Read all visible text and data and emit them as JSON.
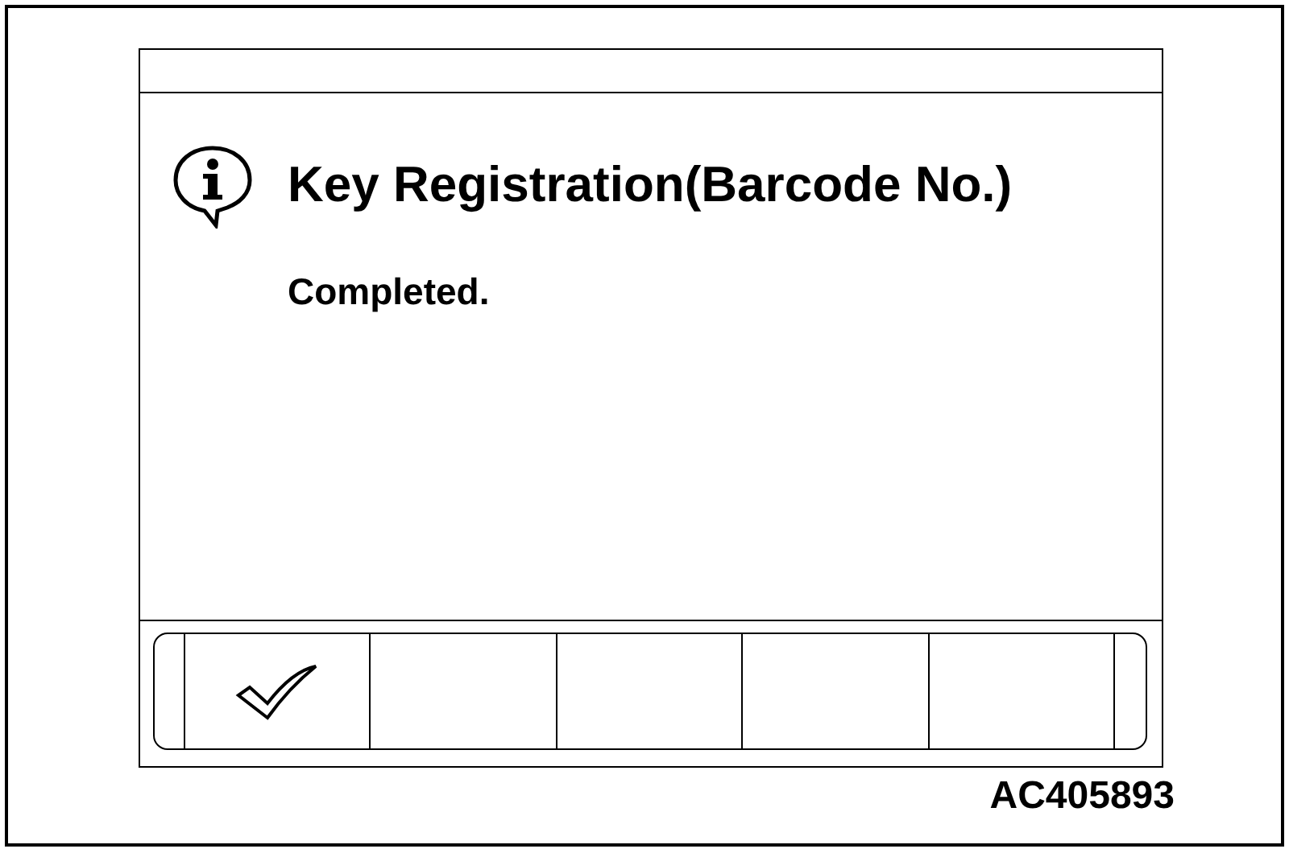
{
  "dialog": {
    "title": "Key Registration(Barcode No.)",
    "message": "Completed."
  },
  "buttons": [
    {
      "kind": "check"
    },
    {
      "kind": "blank"
    },
    {
      "kind": "blank"
    },
    {
      "kind": "blank"
    },
    {
      "kind": "blank"
    }
  ],
  "figure_code": "AC405893"
}
